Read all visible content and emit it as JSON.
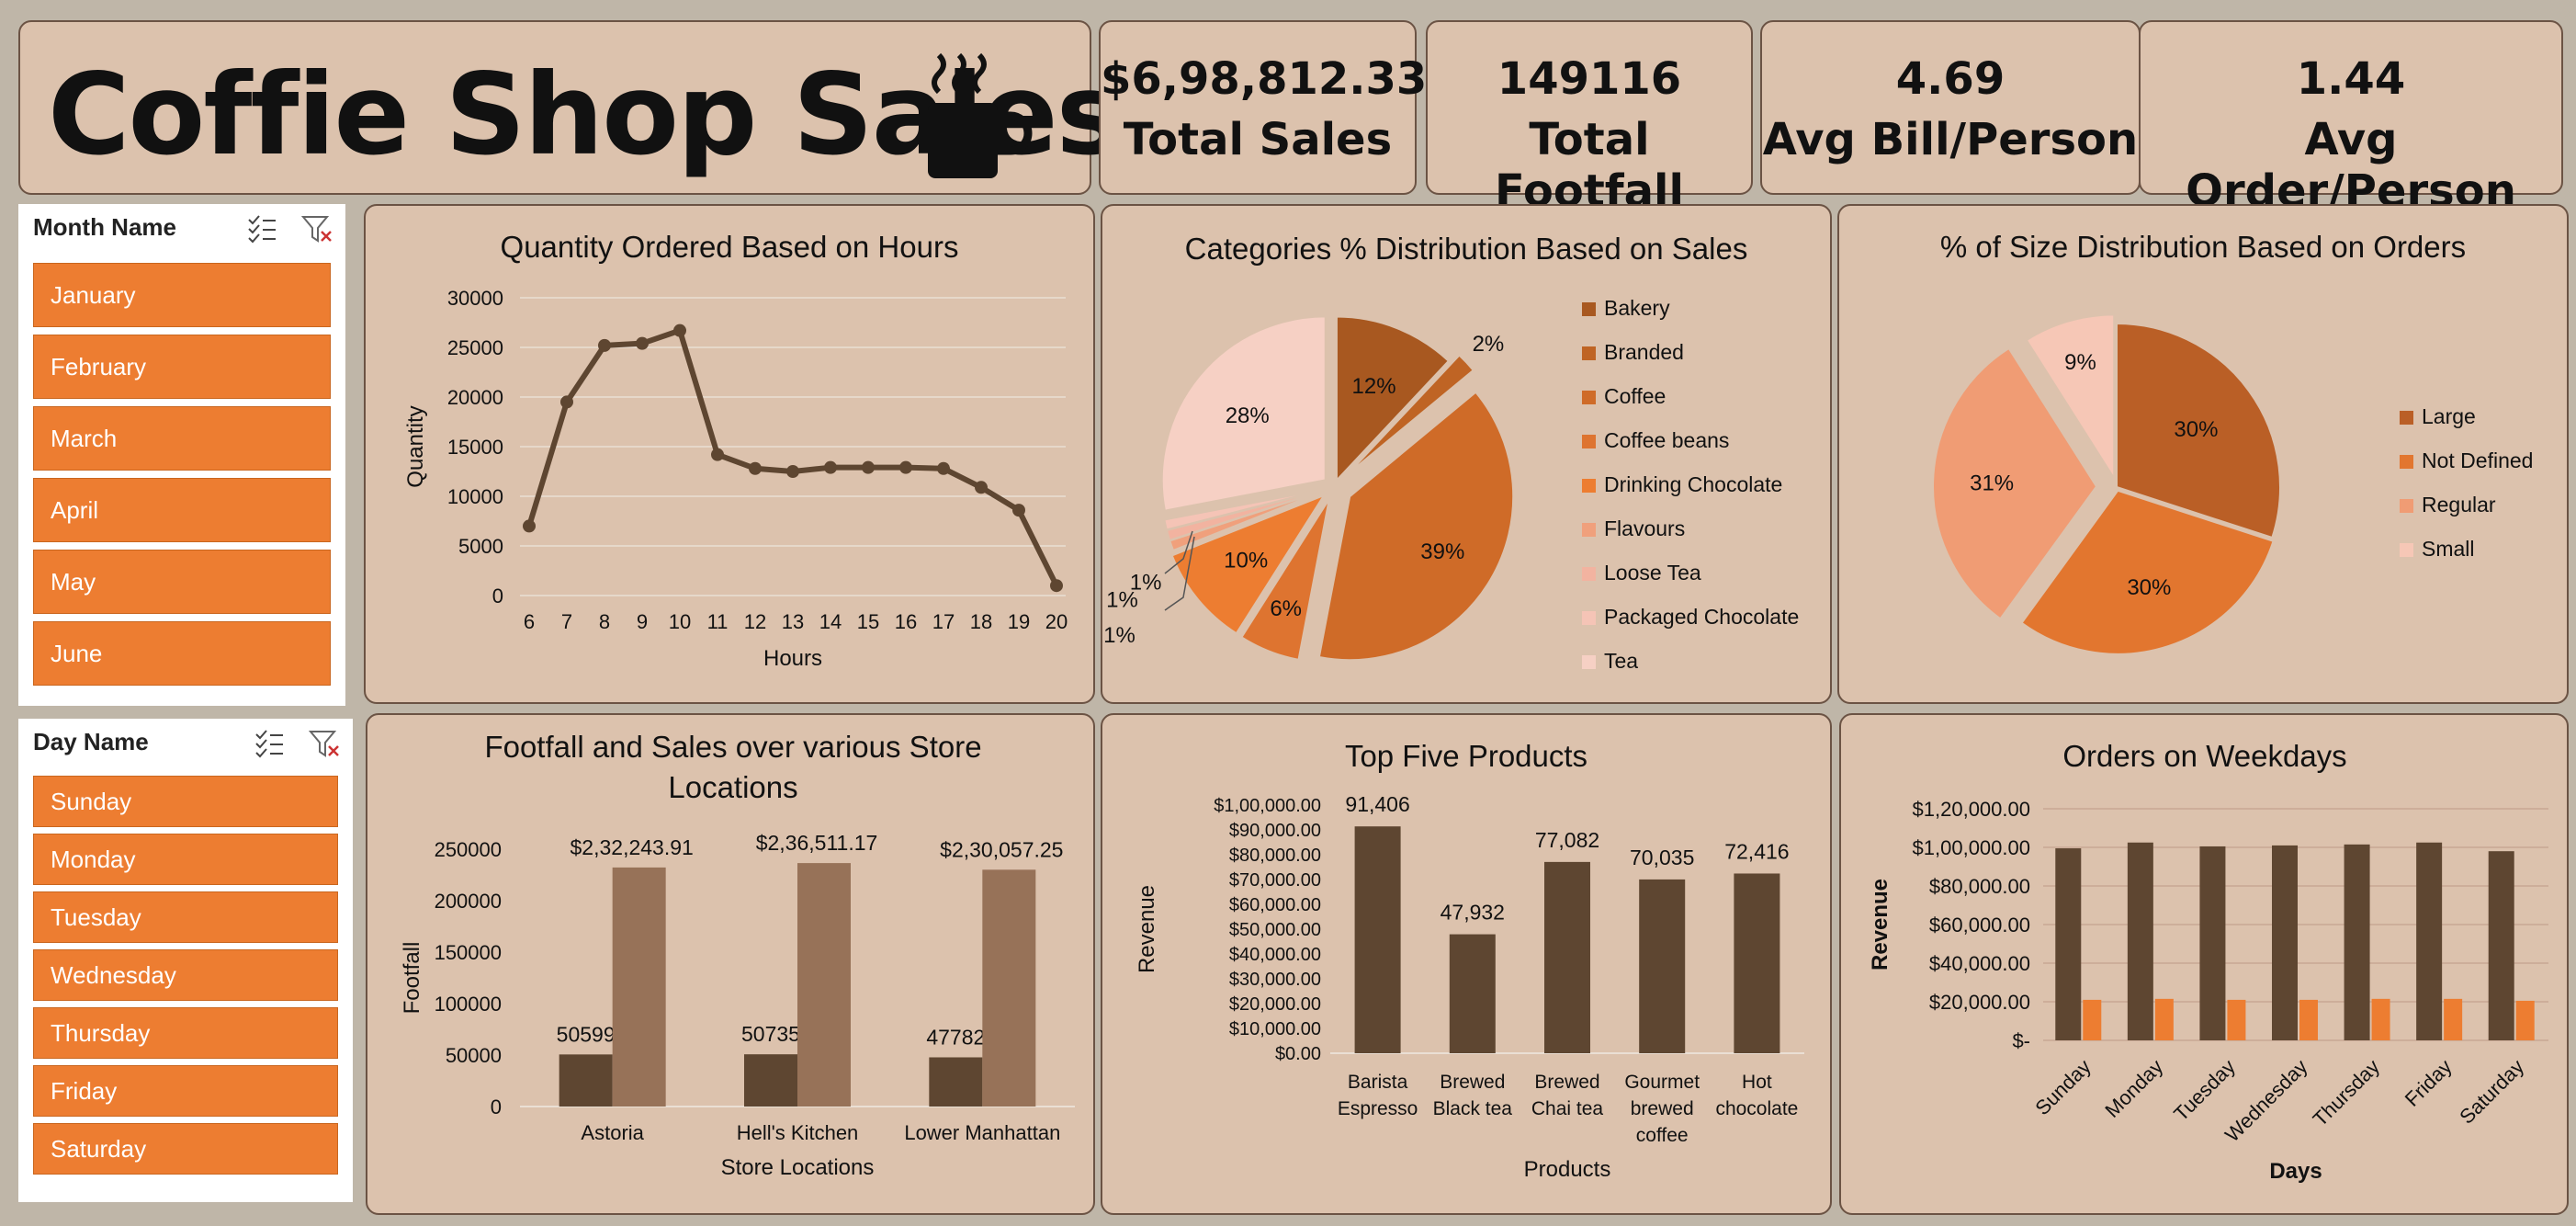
{
  "header": {
    "title": "Coffie Shop Sales",
    "icon": "coffee-mug-icon"
  },
  "kpis": [
    {
      "value": "$6,98,812.33",
      "label": "Total Sales"
    },
    {
      "value": "149116",
      "label": "Total Footfall"
    },
    {
      "value": "4.69",
      "label": "Avg Bill/Person"
    },
    {
      "value": "1.44",
      "label": "Avg Order/Person"
    }
  ],
  "month_slicer": {
    "title": "Month Name",
    "items": [
      "January",
      "February",
      "March",
      "April",
      "May",
      "June"
    ]
  },
  "day_slicer": {
    "title": "Day Name",
    "items": [
      "Sunday",
      "Monday",
      "Tuesday",
      "Wednesday",
      "Thursday",
      "Friday",
      "Saturday"
    ]
  },
  "colors": {
    "dark_brown": "#5e4631",
    "light_brown": "#977258",
    "orange": "#ed7d31",
    "panel": "#dcc2ad"
  },
  "chart_data": [
    {
      "type": "line",
      "title": "Quantity Ordered Based on Hours",
      "xlabel": "Hours",
      "ylabel": "Quantity",
      "x": [
        6,
        7,
        8,
        9,
        10,
        11,
        12,
        13,
        14,
        15,
        16,
        17,
        18,
        19,
        20
      ],
      "values": [
        7000,
        19500,
        25200,
        25400,
        26700,
        14200,
        12800,
        12500,
        12900,
        12900,
        12900,
        12800,
        10900,
        8600,
        1000
      ],
      "ylim": [
        0,
        30000
      ],
      "yticks": [
        "0",
        "5000",
        "10000",
        "15000",
        "20000",
        "25000",
        "30000"
      ],
      "grid": true
    },
    {
      "type": "pie",
      "title": "Categories % Distribution Based on Sales",
      "legend_position": "right",
      "labels": [
        "Bakery",
        "Branded",
        "Coffee",
        "Coffee beans",
        "Drinking Chocolate",
        "Flavours",
        "Loose Tea",
        "Packaged Chocolate",
        "Tea"
      ],
      "values": [
        12,
        2,
        39,
        6,
        10,
        1,
        1,
        1,
        28
      ],
      "value_labels": [
        "12%",
        "2%",
        "39%",
        "6%",
        "10%",
        "1%",
        "1%",
        "1%",
        "28%"
      ],
      "colors": [
        "#a85820",
        "#bf6424",
        "#cf6b28",
        "#de7430",
        "#ed7d31",
        "#f0a07c",
        "#f2b3a0",
        "#f5c4b6",
        "#f6d0c4"
      ]
    },
    {
      "type": "pie",
      "title": "% of Size Distribution Based on Orders",
      "legend_position": "right",
      "labels": [
        "Large",
        "Not Defined",
        "Regular",
        "Small"
      ],
      "values": [
        30,
        30,
        31,
        9
      ],
      "value_labels": [
        "30%",
        "30%",
        "31%",
        "9%"
      ],
      "colors": [
        "#ba5f26",
        "#e2762f",
        "#f09c74",
        "#f6c7b6"
      ]
    },
    {
      "type": "bar",
      "title": "Footfall and Sales over various Store Locations",
      "xlabel": "Store Locations",
      "ylabel": "Footfall",
      "categories": [
        "Astoria",
        "Hell's Kitchen",
        "Lower Manhattan"
      ],
      "series": [
        {
          "name": "Footfall",
          "values": [
            50599,
            50735,
            47782
          ],
          "labels": [
            "50599",
            "50735",
            "47782"
          ]
        },
        {
          "name": "Sales",
          "values": [
            232243.91,
            236511.17,
            230057.25
          ],
          "labels": [
            "$2,32,243.91",
            "$2,36,511.17",
            "$2,30,057.25"
          ]
        }
      ],
      "ylim": [
        0,
        250000
      ],
      "yticks": [
        "0",
        "50000",
        "100000",
        "150000",
        "200000",
        "250000"
      ]
    },
    {
      "type": "bar",
      "title": "Top Five Products",
      "xlabel": "Products",
      "ylabel": "Revenue",
      "categories": [
        "Barista Espresso",
        "Brewed Black tea",
        "Brewed Chai tea",
        "Gourmet brewed coffee",
        "Hot chocolate"
      ],
      "category_lines": [
        [
          "Barista",
          "Espresso"
        ],
        [
          "Brewed",
          "Black tea"
        ],
        [
          "Brewed",
          "Chai tea"
        ],
        [
          "Gourmet",
          "brewed",
          "coffee"
        ],
        [
          "Hot",
          "chocolate"
        ]
      ],
      "values": [
        91406,
        47932,
        77082,
        70035,
        72416
      ],
      "value_labels": [
        "91,406",
        "47,932",
        "77,082",
        "70,035",
        "72,416"
      ],
      "ylim": [
        0,
        100000
      ],
      "yticks": [
        "$0.00",
        "$10,000.00",
        "$20,000.00",
        "$30,000.00",
        "$40,000.00",
        "$50,000.00",
        "$60,000.00",
        "$70,000.00",
        "$80,000.00",
        "$90,000.00",
        "$1,00,000.00"
      ]
    },
    {
      "type": "bar",
      "title": "Orders on Weekdays",
      "xlabel": "Days",
      "ylabel": "Revenue",
      "categories": [
        "Sunday",
        "Monday",
        "Tuesday",
        "Wednesday",
        "Thursday",
        "Friday",
        "Saturday"
      ],
      "series": [
        {
          "values": [
            99500,
            102500,
            100500,
            101000,
            101500,
            102500,
            98000
          ]
        },
        {
          "values": [
            21000,
            21500,
            21000,
            21000,
            21500,
            21500,
            20500
          ]
        }
      ],
      "ylim": [
        0,
        120000
      ],
      "yticks": [
        "$-",
        "$20,000.00",
        "$40,000.00",
        "$60,000.00",
        "$80,000.00",
        "$1,00,000.00",
        "$1,20,000.00"
      ],
      "grid": true
    }
  ]
}
